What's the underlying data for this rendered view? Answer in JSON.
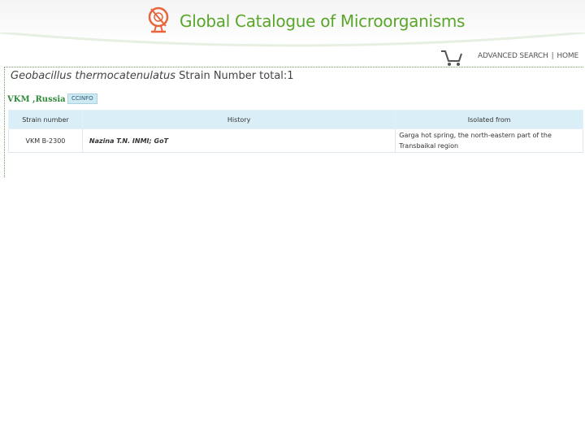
{
  "header": {
    "site_title": "Global Catalogue of Microorganisms",
    "brand_color": "#5aa62a",
    "logo_icon": "microbe-logo-icon"
  },
  "topnav": {
    "cart_icon": "shopping-cart-icon",
    "advanced_search": "ADVANCED SEARCH",
    "separator": "|",
    "home": "HOME"
  },
  "heading": {
    "species": "Geobacillus thermocatenulatus",
    "suffix": " Strain Number total:1"
  },
  "collection": {
    "name": "VKM ,Russia",
    "badge": "CCINFO"
  },
  "table": {
    "headers": [
      "Strain number",
      "History",
      "Isolated from"
    ],
    "rows": [
      {
        "strain_number": "VKM B-2300",
        "history": "Nazina T.N. INMI; GoT",
        "isolated_from": "Garga hot spring, the north-eastern part of the Transbaikal region"
      }
    ]
  }
}
